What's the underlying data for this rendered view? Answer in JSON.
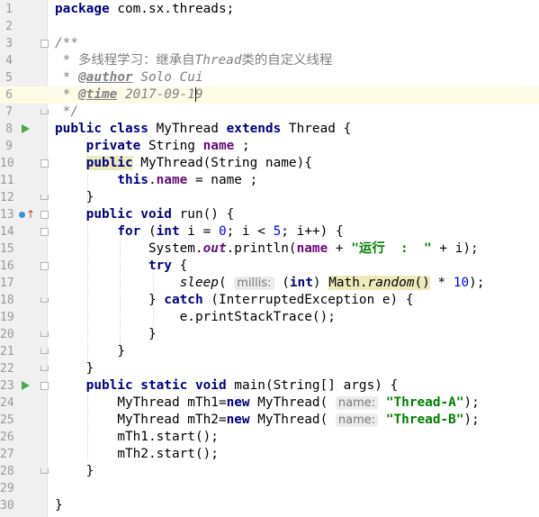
{
  "editor": {
    "line_numbers": [
      "1",
      "2",
      "3",
      "4",
      "5",
      "6",
      "7",
      "8",
      "9",
      "10",
      "11",
      "12",
      "13",
      "14",
      "15",
      "16",
      "17",
      "18",
      "19",
      "20",
      "21",
      "22",
      "23",
      "24",
      "25",
      "26",
      "27",
      "28",
      "29",
      "30"
    ],
    "line_1": {
      "kw_package": "package",
      "pkg": " com.sx.threads;"
    },
    "line_3": {
      "open": "/**"
    },
    "line_4": {
      "star": " * ",
      "text_a": "多线程学习：继承自",
      "text_b": "Thread",
      "text_c": "类的自定义线程"
    },
    "line_5": {
      "star": " * ",
      "tag": "@author",
      "value": " Solo Cui"
    },
    "line_6": {
      "star": " * ",
      "tag": "@time",
      "value_a": " 2017-09-1",
      "value_b": "9"
    },
    "line_7": {
      "close": " */"
    },
    "line_8": {
      "kw_public": "public",
      "kw_class": " class",
      "name": " MyThread",
      "kw_extends": " extends",
      "rest": " Thread {"
    },
    "line_9": {
      "kw_private": "private",
      "type": " String ",
      "field": "name",
      "rest": " ;"
    },
    "line_10": {
      "kw_public": "public",
      "rest": " MyThread(String name){"
    },
    "line_11": {
      "kw_this": "this",
      "dot": ".",
      "field": "name",
      "rest": " = name ;"
    },
    "line_12": {
      "brace": "}"
    },
    "line_13": {
      "kw_public": "public",
      "kw_void": " void",
      "rest": " run() {"
    },
    "line_14": {
      "kw_for": "for",
      "open": " (",
      "kw_int": "int",
      "mid": " i = ",
      "zero": "0",
      "mid2": "; i < ",
      "five": "5",
      "rest": "; i++) {"
    },
    "line_15": {
      "pre": "System.",
      "out": "out",
      "mid": ".println(",
      "field": "name",
      "plus": " + ",
      "str": "\"运行  :  \"",
      "rest": " + i);"
    },
    "line_16": {
      "kw_try": "try",
      "rest": " {"
    },
    "line_17": {
      "sleep": "sleep",
      "open": "( ",
      "hint": "millis:",
      "p1": " (",
      "kw_int": "int",
      "p2": ") ",
      "math": "Math.",
      "random": "random",
      "paren": "()",
      "times": " * ",
      "ten": "10",
      "rest": ");"
    },
    "line_18": {
      "pre": "} ",
      "kw_catch": "catch",
      "rest": " (InterruptedException e) {"
    },
    "line_19": {
      "text": "e.printStackTrace();"
    },
    "line_20": {
      "brace": "}"
    },
    "line_21": {
      "brace": "}"
    },
    "line_22": {
      "brace": "}"
    },
    "line_23": {
      "kw_public": "public",
      "kw_static": " static",
      "kw_void": " void",
      "rest": " main(String[] args) {"
    },
    "line_24": {
      "pre": "MyThread mTh1=",
      "kw_new": "new",
      "mid": " MyThread( ",
      "hint": "name:",
      "sp": " ",
      "str": "\"Thread-A\"",
      "rest": ");"
    },
    "line_25": {
      "pre": "MyThread mTh2=",
      "kw_new": "new",
      "mid": " MyThread( ",
      "hint": "name:",
      "sp": " ",
      "str": "\"Thread-B\"",
      "rest": ");"
    },
    "line_26": {
      "text": "mTh1.start();"
    },
    "line_27": {
      "text": "mTh2.start();"
    },
    "line_28": {
      "brace": "}"
    },
    "line_30": {
      "brace": "}"
    }
  },
  "colors": {
    "keyword": "#000080",
    "field": "#660e7a",
    "string": "#008000",
    "number": "#0000ff",
    "comment": "#808080",
    "gutter": "#f0f0f0",
    "current_line": "#fdfbe6"
  },
  "gutter_icons": [
    "run-icon",
    "override-icon",
    "run-icon"
  ]
}
